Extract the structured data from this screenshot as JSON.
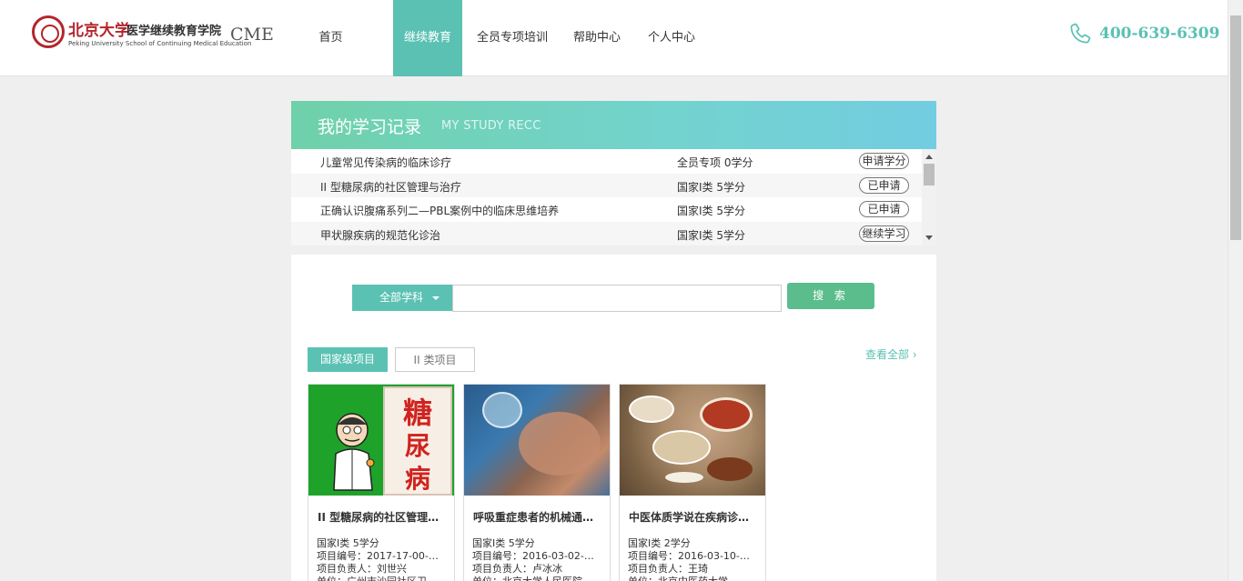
{
  "header": {
    "logo": {
      "cn_university": "北京大学",
      "cn_school": "医学继续教育学院",
      "en": "Peking University School of Continuing Medical Education",
      "mark": "CME"
    },
    "nav": [
      {
        "label": "首页",
        "active": false
      },
      {
        "label": "继续教育",
        "active": true
      },
      {
        "label": "全员专项培训",
        "active": false
      },
      {
        "label": "帮助中心",
        "active": false
      },
      {
        "label": "个人中心",
        "active": false
      }
    ],
    "phone": "400-639-6309",
    "accent_color": "#5bc1b3"
  },
  "study_record": {
    "title": "我的学习记录",
    "subtitle": "MY STUDY RECC",
    "rows": [
      {
        "name": "儿童常见传染病的临床诊疗",
        "type": "全员专项 0学分",
        "action": "申请学分"
      },
      {
        "name": "II 型糖尿病的社区管理与治疗",
        "type": "国家I类 5学分",
        "action": "已申请"
      },
      {
        "name": "正确认识腹痛系列二—PBL案例中的临床思维培养",
        "type": "国家I类 5学分",
        "action": "已申请"
      },
      {
        "name": "甲状腺疾病的规范化诊治",
        "type": "国家I类 5学分",
        "action": "继续学习"
      }
    ]
  },
  "search": {
    "subject_label": "全部学科",
    "input_value": "",
    "button_label": "搜 索"
  },
  "tabs": [
    {
      "label": "国家级项目",
      "active": true
    },
    {
      "label": "II 类项目",
      "active": false
    }
  ],
  "view_all": "查看全部 ›",
  "cards": [
    {
      "title": "II 型糖尿病的社区管理…",
      "credit": "国家I类 5学分",
      "code": "项目编号：2017-17-00-…",
      "leader": "项目负责人：刘世兴",
      "unit": "单位：广州市沙园社区卫…",
      "image_chars": [
        "糖",
        "尿",
        "病"
      ]
    },
    {
      "title": "呼吸重症患者的机械通…",
      "credit": "国家I类 5学分",
      "code": "项目编号：2016-03-02-…",
      "leader": "项目负责人：卢冰冰",
      "unit": "单位：北京大学人民医院"
    },
    {
      "title": "中医体质学说在疾病诊…",
      "credit": "国家I类 2学分",
      "code": "项目编号：2016-03-10-…",
      "leader": "项目负责人：王琦",
      "unit": "单位：北京中医药大学"
    }
  ]
}
